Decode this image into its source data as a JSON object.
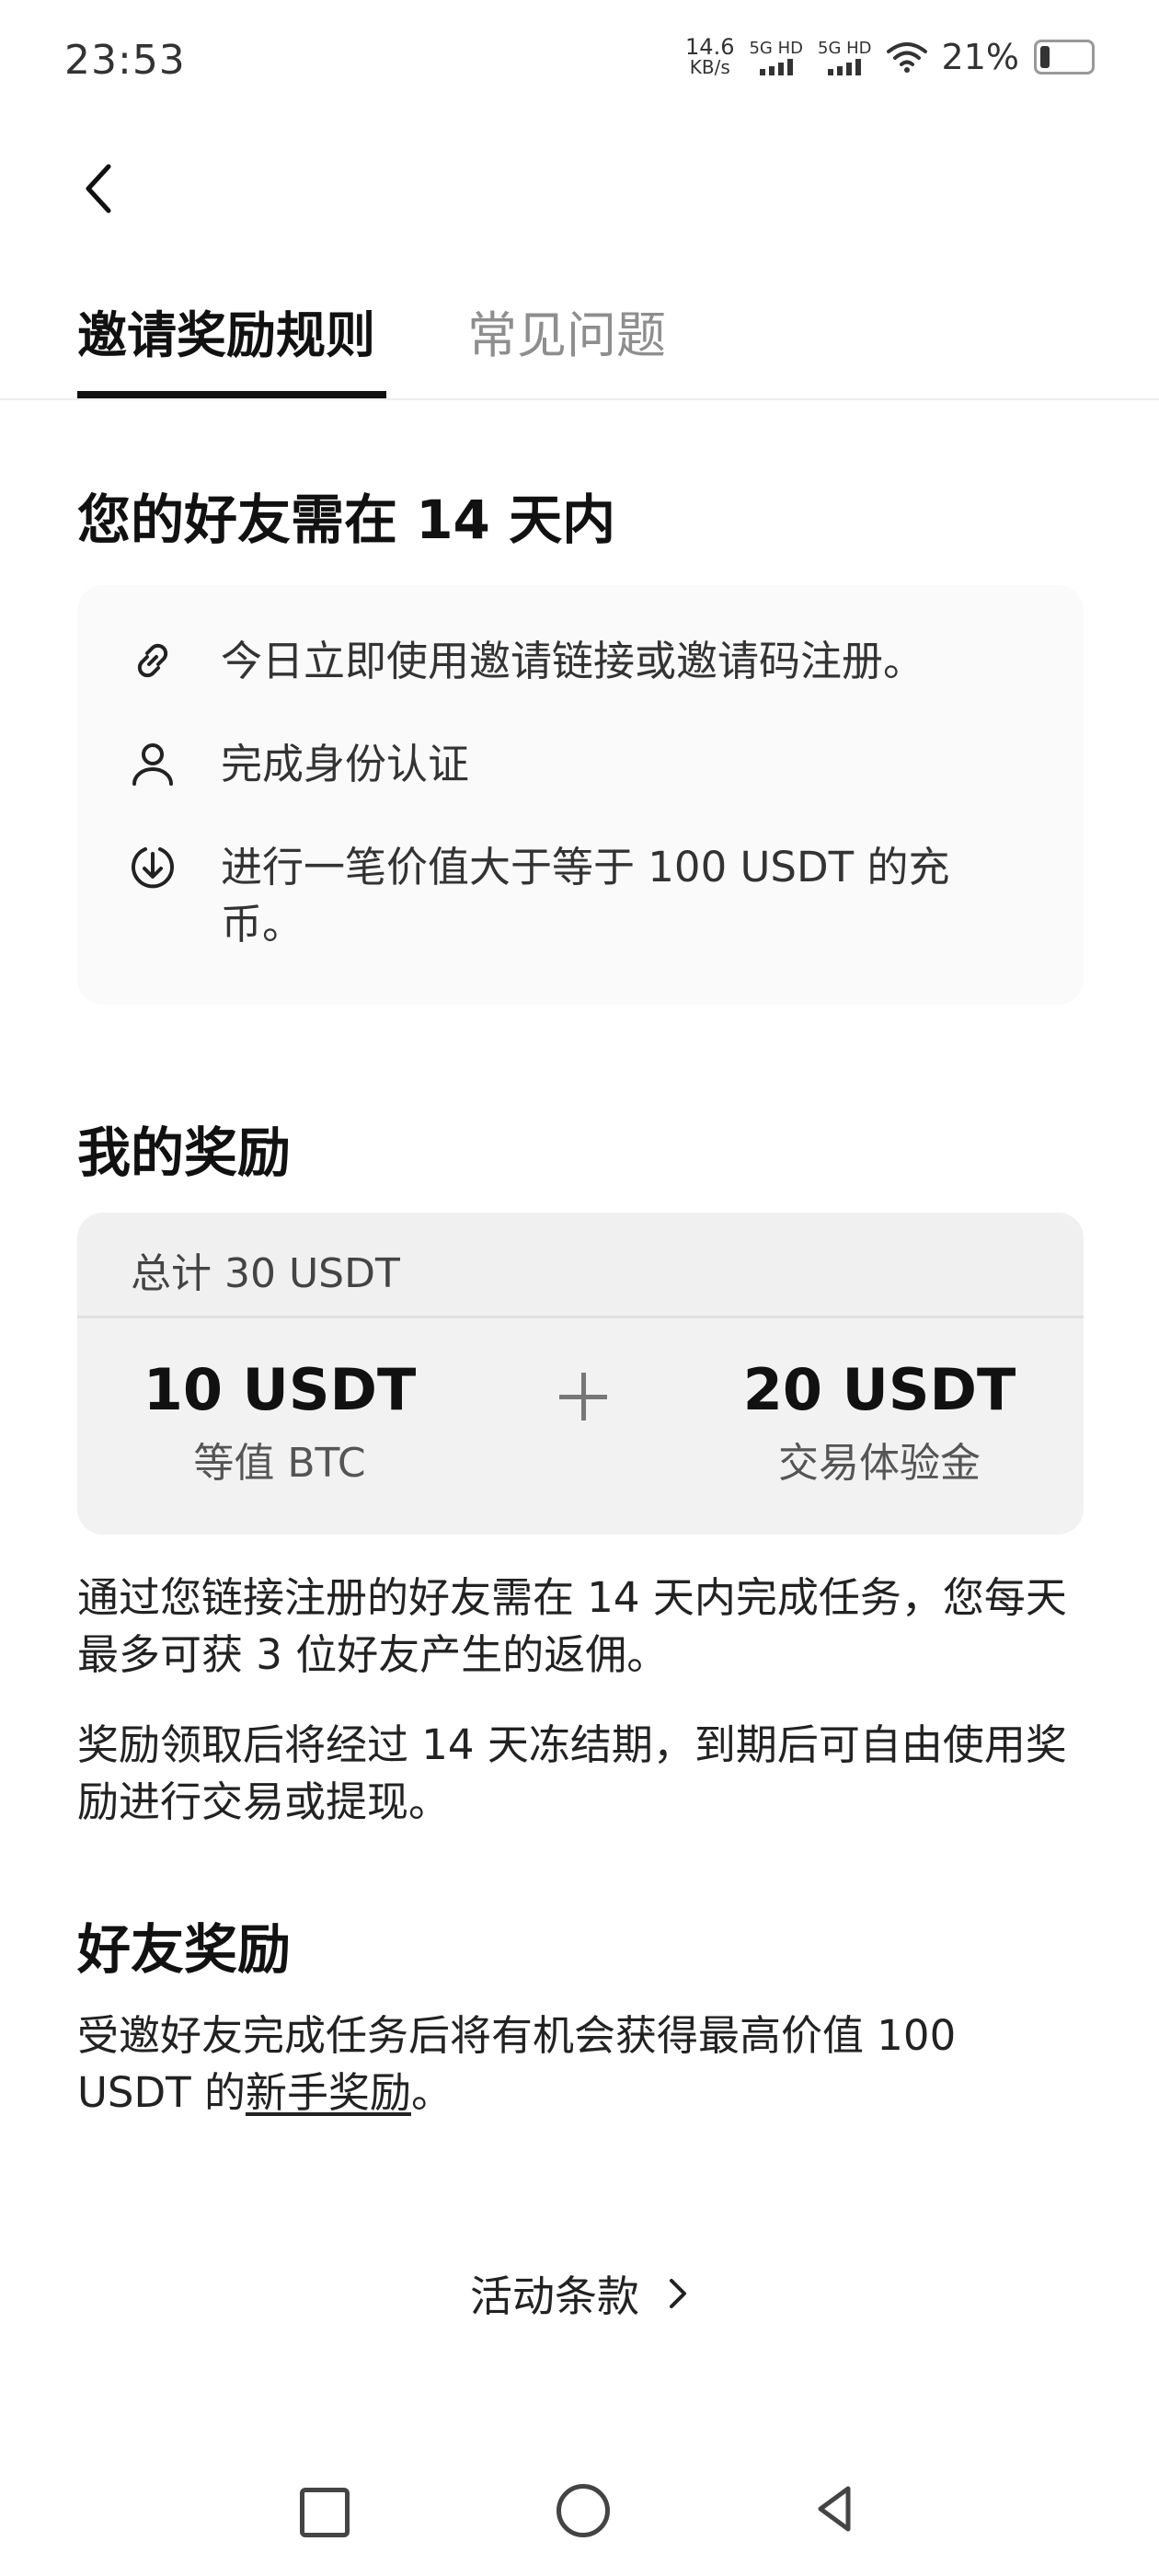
{
  "status_bar": {
    "time": "23:53",
    "net_speed": "14.6",
    "net_speed_unit": "KB/s",
    "signal1_label": "5G HD",
    "signal2_label": "5G HD",
    "battery_percent": "21%"
  },
  "tabs": [
    {
      "label": "邀请奖励规则",
      "active": true
    },
    {
      "label": "常见问题",
      "active": false
    }
  ],
  "section_friend_tasks": {
    "title": "您的好友需在 14 天内",
    "steps": [
      {
        "icon": "link-icon",
        "text": "今日立即使用邀请链接或邀请码注册。"
      },
      {
        "icon": "user-icon",
        "text": "完成身份认证"
      },
      {
        "icon": "deposit-icon",
        "text": "进行一笔价值大于等于 100 USDT 的充币。"
      }
    ]
  },
  "section_my_rewards": {
    "title": "我的奖励",
    "total": "总计 30 USDT",
    "left_amount": "10 USDT",
    "left_desc": "等值 BTC",
    "right_amount": "20 USDT",
    "right_desc": "交易体验金",
    "paragraph1": "通过您链接注册的好友需在 14 天内完成任务，您每天最多可获 3 位好友产生的返佣。",
    "paragraph2": "奖励领取后将经过 14 天冻结期，到期后可自由使用奖励进行交易或提现。"
  },
  "section_friend_rewards": {
    "title": "好友奖励",
    "text_before_link": "受邀好友完成任务后将有机会获得最高价值 100 USDT 的",
    "link_text": "新手奖励",
    "text_after_link": "。"
  },
  "terms_link": "活动条款",
  "colors": {
    "text_primary": "#111111",
    "text_secondary": "#8e8e8e",
    "card_bg": "#fafafa",
    "reward_bg": "#f2f2f2"
  }
}
